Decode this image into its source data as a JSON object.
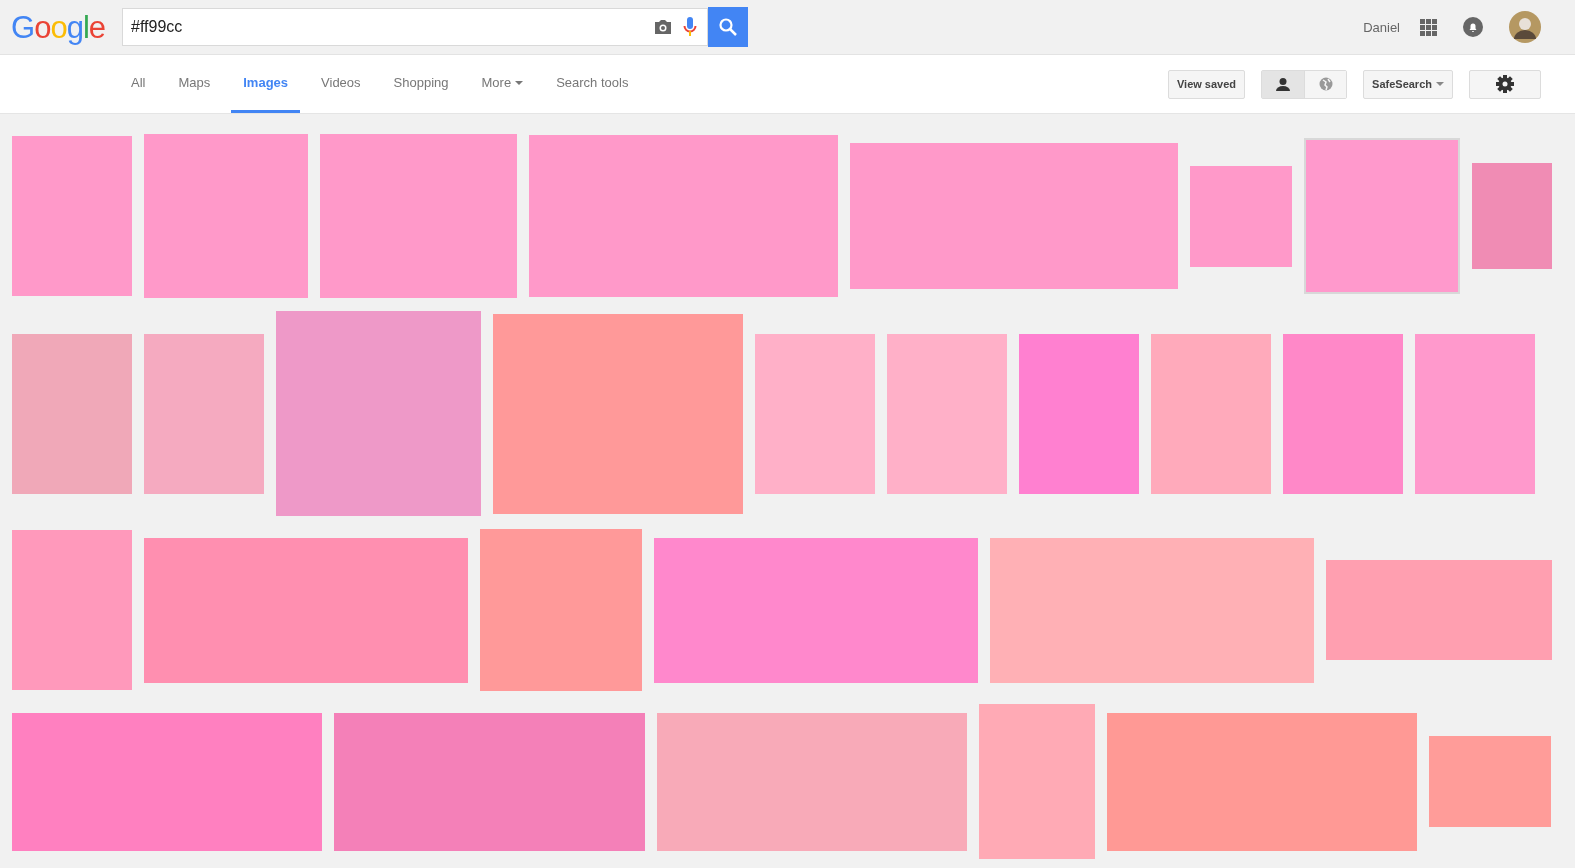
{
  "logo": "Google",
  "search": {
    "value": "#ff99cc"
  },
  "account": {
    "name": "Daniel"
  },
  "tabs": [
    {
      "label": "All",
      "selected": false,
      "kind": "tab"
    },
    {
      "label": "Maps",
      "selected": false,
      "kind": "tab"
    },
    {
      "label": "Images",
      "selected": true,
      "kind": "tab"
    },
    {
      "label": "Videos",
      "selected": false,
      "kind": "tab"
    },
    {
      "label": "Shopping",
      "selected": false,
      "kind": "tab"
    },
    {
      "label": "More",
      "selected": false,
      "kind": "menu"
    },
    {
      "label": "Search tools",
      "selected": false,
      "kind": "tab"
    }
  ],
  "tools": {
    "view_saved": "View saved",
    "scope": [
      {
        "kind": "person",
        "selected": true
      },
      {
        "kind": "globe",
        "selected": false
      }
    ],
    "safesearch": "SafeSearch"
  },
  "results": [
    [
      {
        "color": "#ff99c9"
      },
      {
        "color": "#ff99c9"
      },
      {
        "color": "#ff99c9"
      },
      {
        "color": "#ff99c9"
      },
      {
        "color": "#ff99c9"
      },
      {
        "color": "#ff99c9"
      },
      {
        "color": "#ff99cc",
        "selected": true
      },
      {
        "color": "#f08cb4"
      }
    ],
    [
      {
        "color": "#f0a8b8"
      },
      {
        "color": "#f5aac0"
      },
      {
        "color": "#ee99c8"
      },
      {
        "color": "#ff9999"
      },
      {
        "color": "#ffb0c8"
      },
      {
        "color": "#ffb0c8"
      },
      {
        "color": "#ff80d0"
      },
      {
        "color": "#ffaabb"
      },
      {
        "color": "#ff88c8"
      },
      {
        "color": "#ff99cc"
      }
    ],
    [
      {
        "color": "#ff99bb"
      },
      {
        "color": "#ff8fb0"
      },
      {
        "color": "#ff9999"
      },
      {
        "color": "#ff88cc"
      },
      {
        "color": "#ffb0b5"
      },
      {
        "color": "#ff9fb0"
      }
    ],
    [
      {
        "color": "#ff80c0"
      },
      {
        "color": "#f480b8"
      },
      {
        "color": "#f8aab8"
      },
      {
        "color": "#ffaab5"
      },
      {
        "color": "#ff9995"
      },
      {
        "color": "#ff9c99"
      }
    ]
  ]
}
